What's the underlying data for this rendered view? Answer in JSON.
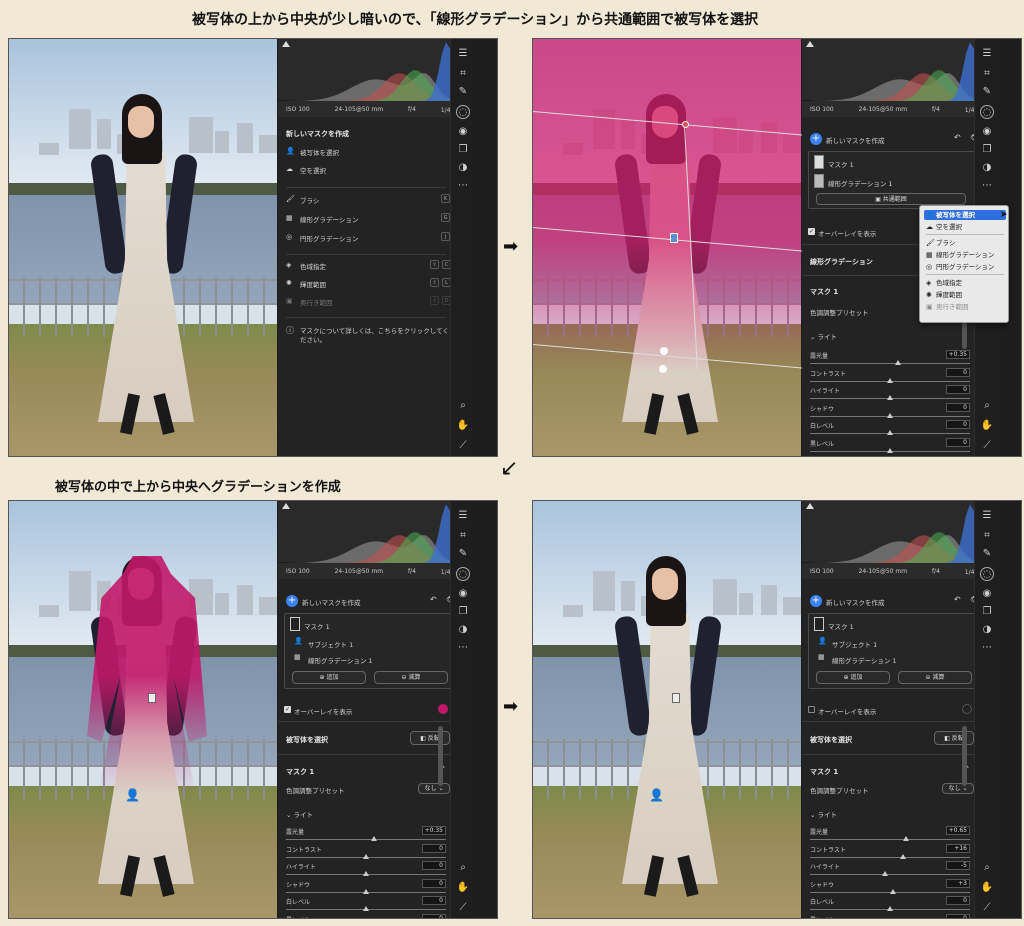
{
  "captions": {
    "top": "被写体の上から中央が少し暗いので、「線形グラデーション」から共通範囲で被写体を選択",
    "middle": "被写体の中で上から中央へグラデーションを作成"
  },
  "arrows": {
    "right": "➡",
    "down_left": "↙"
  },
  "exif": {
    "iso": "ISO 100",
    "lens": "24-105@50 mm",
    "aperture": "f/4",
    "shutter": "1/400 秒"
  },
  "rail_icons": [
    "sliders-icon",
    "crop-icon",
    "brush-icon",
    "mask-icon",
    "eye-icon",
    "copy-icon",
    "circles-icon",
    "more-icon",
    "zoom-icon",
    "hand-icon",
    "eyedropper-icon"
  ],
  "panel1": {
    "header": "新しいマスクを作成",
    "items_a": [
      {
        "label": "被写体を選択",
        "icon": "👤"
      },
      {
        "label": "空を選択",
        "icon": "☁"
      }
    ],
    "items_b": [
      {
        "label": "ブラシ",
        "icon": "🖌",
        "key": "K"
      },
      {
        "label": "線形グラデーション",
        "icon": "▦",
        "key": "G"
      },
      {
        "label": "円形グラデーション",
        "icon": "◎",
        "key": "J"
      }
    ],
    "items_c": [
      {
        "label": "色域指定",
        "icon": "◈",
        "key1": "⇧",
        "key2": "C"
      },
      {
        "label": "輝度範囲",
        "icon": "✺",
        "key1": "⇧",
        "key2": "L"
      },
      {
        "label": "奥行き範囲",
        "icon": "▣",
        "key1": "⇧",
        "key2": "D"
      }
    ],
    "help": "マスクについて詳しくは、こちらをクリックしてください。"
  },
  "panel2": {
    "header": "新しいマスクを作成",
    "mask_name": "マスク 1",
    "component": "線形グラデーション 1",
    "intersect_button": "共通範囲",
    "overlay_label": "オーバーレイを表示",
    "section": "線形グラデーション",
    "mask_title": "マスク 1",
    "preset_label": "色調調整プリセット",
    "light_label": "ライト",
    "sliders": [
      {
        "label": "露光量",
        "value": "+0.35",
        "pos": 0.55
      },
      {
        "label": "コントラスト",
        "value": "0",
        "pos": 0.5
      },
      {
        "label": "ハイライト",
        "value": "0",
        "pos": 0.5
      },
      {
        "label": "シャドウ",
        "value": "0",
        "pos": 0.5
      },
      {
        "label": "白レベル",
        "value": "0",
        "pos": 0.5
      },
      {
        "label": "黒レベル",
        "value": "0",
        "pos": 0.5
      }
    ],
    "popup": [
      {
        "label": "被写体を選択",
        "icon": "👤",
        "selected": true
      },
      {
        "label": "空を選択",
        "icon": "☁",
        "selected": false
      },
      {
        "label": "ブラシ",
        "icon": "🖌",
        "selected": false
      },
      {
        "label": "線形グラデーション",
        "icon": "▦",
        "selected": false
      },
      {
        "label": "円形グラデーション",
        "icon": "◎",
        "selected": false
      },
      {
        "label": "色域指定",
        "icon": "◈",
        "selected": false
      },
      {
        "label": "輝度範囲",
        "icon": "✺",
        "selected": false
      },
      {
        "label": "奥行き範囲",
        "icon": "▣",
        "selected": false
      }
    ]
  },
  "panel3": {
    "header": "新しいマスクを作成",
    "mask_name": "マスク 1",
    "subject": "サブジェクト 1",
    "component": "線形グラデーション 1",
    "add_button": "追加",
    "subtract_button": "減算",
    "overlay_label": "オーバーレイを表示",
    "overlay_color": "#c2186b",
    "section": "被写体を選択",
    "invert_button": "反転",
    "mask_title": "マスク 1",
    "preset_label": "色調調整プリセット",
    "preset_value": "なし",
    "light_label": "ライト",
    "sliders": [
      {
        "label": "露光量",
        "value": "+0.35",
        "pos": 0.55
      },
      {
        "label": "コントラスト",
        "value": "0",
        "pos": 0.5
      },
      {
        "label": "ハイライト",
        "value": "0",
        "pos": 0.5
      },
      {
        "label": "シャドウ",
        "value": "0",
        "pos": 0.5
      },
      {
        "label": "白レベル",
        "value": "0",
        "pos": 0.5
      },
      {
        "label": "黒レベル",
        "value": "0",
        "pos": 0.5
      }
    ]
  },
  "panel4": {
    "header": "新しいマスクを作成",
    "mask_name": "マスク 1",
    "subject": "サブジェクト 1",
    "component": "線形グラデーション 1",
    "add_button": "追加",
    "subtract_button": "減算",
    "overlay_label": "オーバーレイを表示",
    "section": "被写体を選択",
    "invert_button": "反転",
    "mask_title": "マスク 1",
    "preset_label": "色調調整プリセット",
    "preset_value": "なし",
    "light_label": "ライト",
    "sliders": [
      {
        "label": "露光量",
        "value": "+0.65",
        "pos": 0.6
      },
      {
        "label": "コントラスト",
        "value": "+16",
        "pos": 0.58
      },
      {
        "label": "ハイライト",
        "value": "-5",
        "pos": 0.47
      },
      {
        "label": "シャドウ",
        "value": "+3",
        "pos": 0.52
      },
      {
        "label": "白レベル",
        "value": "0",
        "pos": 0.5
      },
      {
        "label": "黒レベル",
        "value": "0",
        "pos": 0.5
      }
    ]
  }
}
